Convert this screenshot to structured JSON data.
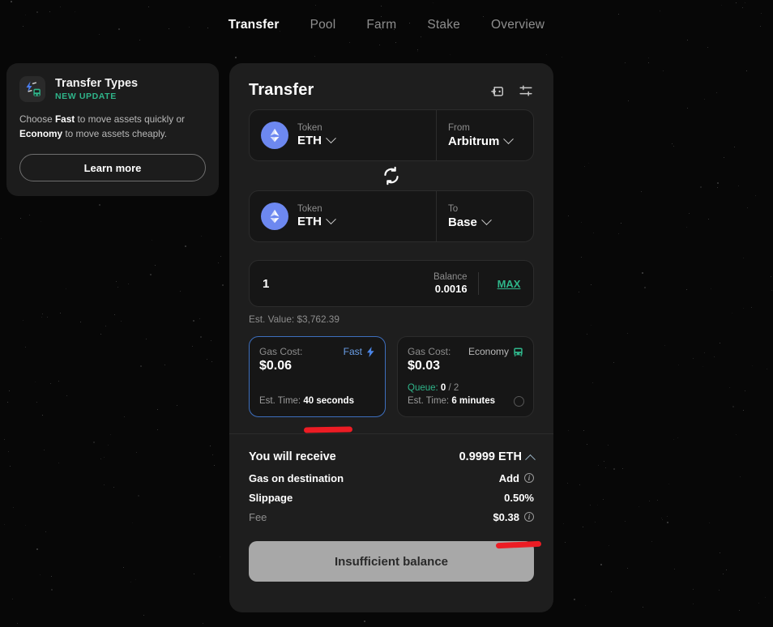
{
  "nav": {
    "items": [
      {
        "label": "Transfer",
        "active": true
      },
      {
        "label": "Pool",
        "active": false
      },
      {
        "label": "Farm",
        "active": false
      },
      {
        "label": "Stake",
        "active": false
      },
      {
        "label": "Overview",
        "active": false
      }
    ]
  },
  "promo": {
    "icon": "bolt-bus-icon",
    "title": "Transfer Types",
    "badge": "NEW UPDATE",
    "body_prefix": "Choose ",
    "body_bold_1": "Fast",
    "body_middle": " to move assets quickly or ",
    "body_bold_2": "Economy",
    "body_suffix": " to move assets cheaply.",
    "button": "Learn more"
  },
  "panel": {
    "title": "Transfer",
    "icons": [
      {
        "name": "add-wallet-icon"
      },
      {
        "name": "settings-sliders-icon"
      }
    ],
    "from_row": {
      "token_label": "Token",
      "token_value": "ETH",
      "token_icon": "eth-icon",
      "chain_label": "From",
      "chain_value": "Arbitrum"
    },
    "swap_icon": "swap-circular-arrows-icon",
    "to_row": {
      "token_label": "Token",
      "token_value": "ETH",
      "token_icon": "eth-icon",
      "chain_label": "To",
      "chain_value": "Base"
    },
    "amount": {
      "value": "1",
      "placeholder": "0.0",
      "balance_label": "Balance",
      "balance_value": "0.0016",
      "max_label": "MAX",
      "est_value": "Est. Value: $3,762.39"
    },
    "gas_options": [
      {
        "gas_label": "Gas Cost:",
        "mode": "Fast",
        "mode_icon": "lightning-bolt-icon",
        "price": "$0.06",
        "time_label": "Est. Time: ",
        "time_value": "40 seconds",
        "selected": true
      },
      {
        "gas_label": "Gas Cost:",
        "mode": "Economy",
        "mode_icon": "bus-icon",
        "price": "$0.03",
        "queue_label": "Queue: ",
        "queue_value": "0",
        "queue_total": " / 2",
        "time_label": "Est. Time: ",
        "time_value": "6 minutes",
        "selected": false
      }
    ],
    "summary": {
      "receive_label": "You will receive",
      "receive_value": "0.9999 ETH",
      "rows": [
        {
          "key": "Gas on destination",
          "value": "Add",
          "info": true,
          "dim": false
        },
        {
          "key": "Slippage",
          "value": "0.50%",
          "info": false,
          "dim": false
        },
        {
          "key": "Fee",
          "value": "$0.38",
          "info": true,
          "dim": true
        }
      ]
    },
    "cta": "Insufficient balance"
  },
  "colors": {
    "accent_teal": "#2fb58a",
    "accent_blue": "#6a9fe8",
    "eth_blue": "#6d88f0",
    "annotation_red": "#ec1c24",
    "panel_bg": "#1e1e1e",
    "field_bg": "#161616"
  }
}
